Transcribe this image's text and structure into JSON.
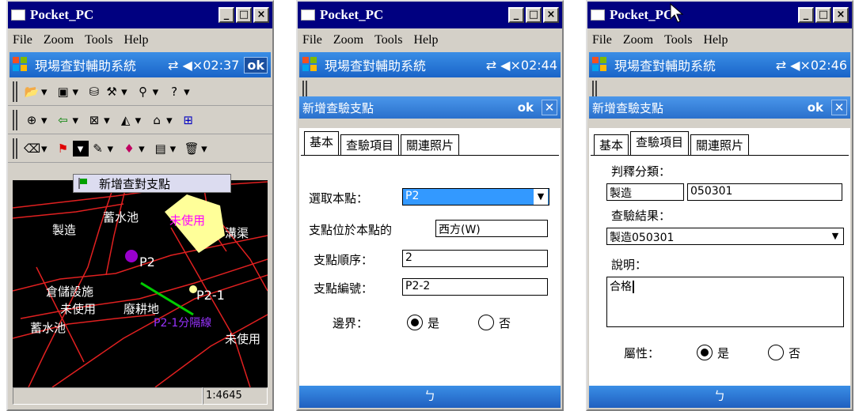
{
  "colors": {
    "title_bg": "#000080",
    "ppc_blue": "#1a64c8",
    "map_bg": "#000000",
    "road_red": "#e02020",
    "yellow_area": "#ffff99",
    "purple_point": "#9900cc",
    "green_line": "#00cc00"
  },
  "windows": [
    {
      "title": "Pocket_PC",
      "menu": [
        "File",
        "Zoom",
        "Tools",
        "Help"
      ],
      "app_title": "現場查對輔助系統",
      "status_icons": "⇄ ◀× ",
      "time": "02:37",
      "ok": "ok",
      "popup_item": "新增查對支點",
      "map_labels": [
        "製造",
        "蓄水池",
        "未使用",
        "溝渠",
        "P2",
        "P2-1",
        "倉儲設施",
        "未使用",
        "蓄水池",
        "廢耕地",
        "P2-1分隔線",
        "未使用"
      ],
      "scale": "1:4645"
    },
    {
      "title": "Pocket_PC",
      "menu": [
        "File",
        "Zoom",
        "Tools",
        "Help"
      ],
      "app_title": "現場查對輔助系統",
      "status_icons": "⇄ ◀× ",
      "time": "02:44",
      "dialog_title": "新增查驗支點",
      "ok": "ok",
      "close": "✕",
      "tabs": [
        "基本",
        "查驗項目",
        "關連照片"
      ],
      "fields": [
        {
          "label": "選取本點：",
          "value": "P2"
        },
        {
          "label": "支點位於本點的",
          "value": "西方(W)"
        },
        {
          "label": "支點順序：",
          "value": "2"
        },
        {
          "label": "支點編號：",
          "value": "P2-2"
        }
      ],
      "radio_label": "邊界：",
      "radio_yes": "是",
      "radio_no": "否",
      "bottom_icon": "ㄅ"
    },
    {
      "title": "Pocket_PC",
      "menu": [
        "File",
        "Zoom",
        "Tools",
        "Help"
      ],
      "app_title": "現場查對輔助系統",
      "status_icons": "⇄ ◀× ",
      "time": "02:46",
      "dialog_title": "新增查驗支點",
      "ok": "ok",
      "close": "✕",
      "tabs": [
        "基本",
        "查驗項目",
        "關連照片"
      ],
      "classify_label": "判釋分類：",
      "classify_name": "製造",
      "classify_code": "050301",
      "result_label": "查驗結果：",
      "result_value": "製造050301",
      "desc_label": "說明：",
      "desc_value": "合格",
      "radio_label": "屬性：",
      "radio_yes": "是",
      "radio_no": "否",
      "bottom_icon": "ㄅ"
    }
  ]
}
